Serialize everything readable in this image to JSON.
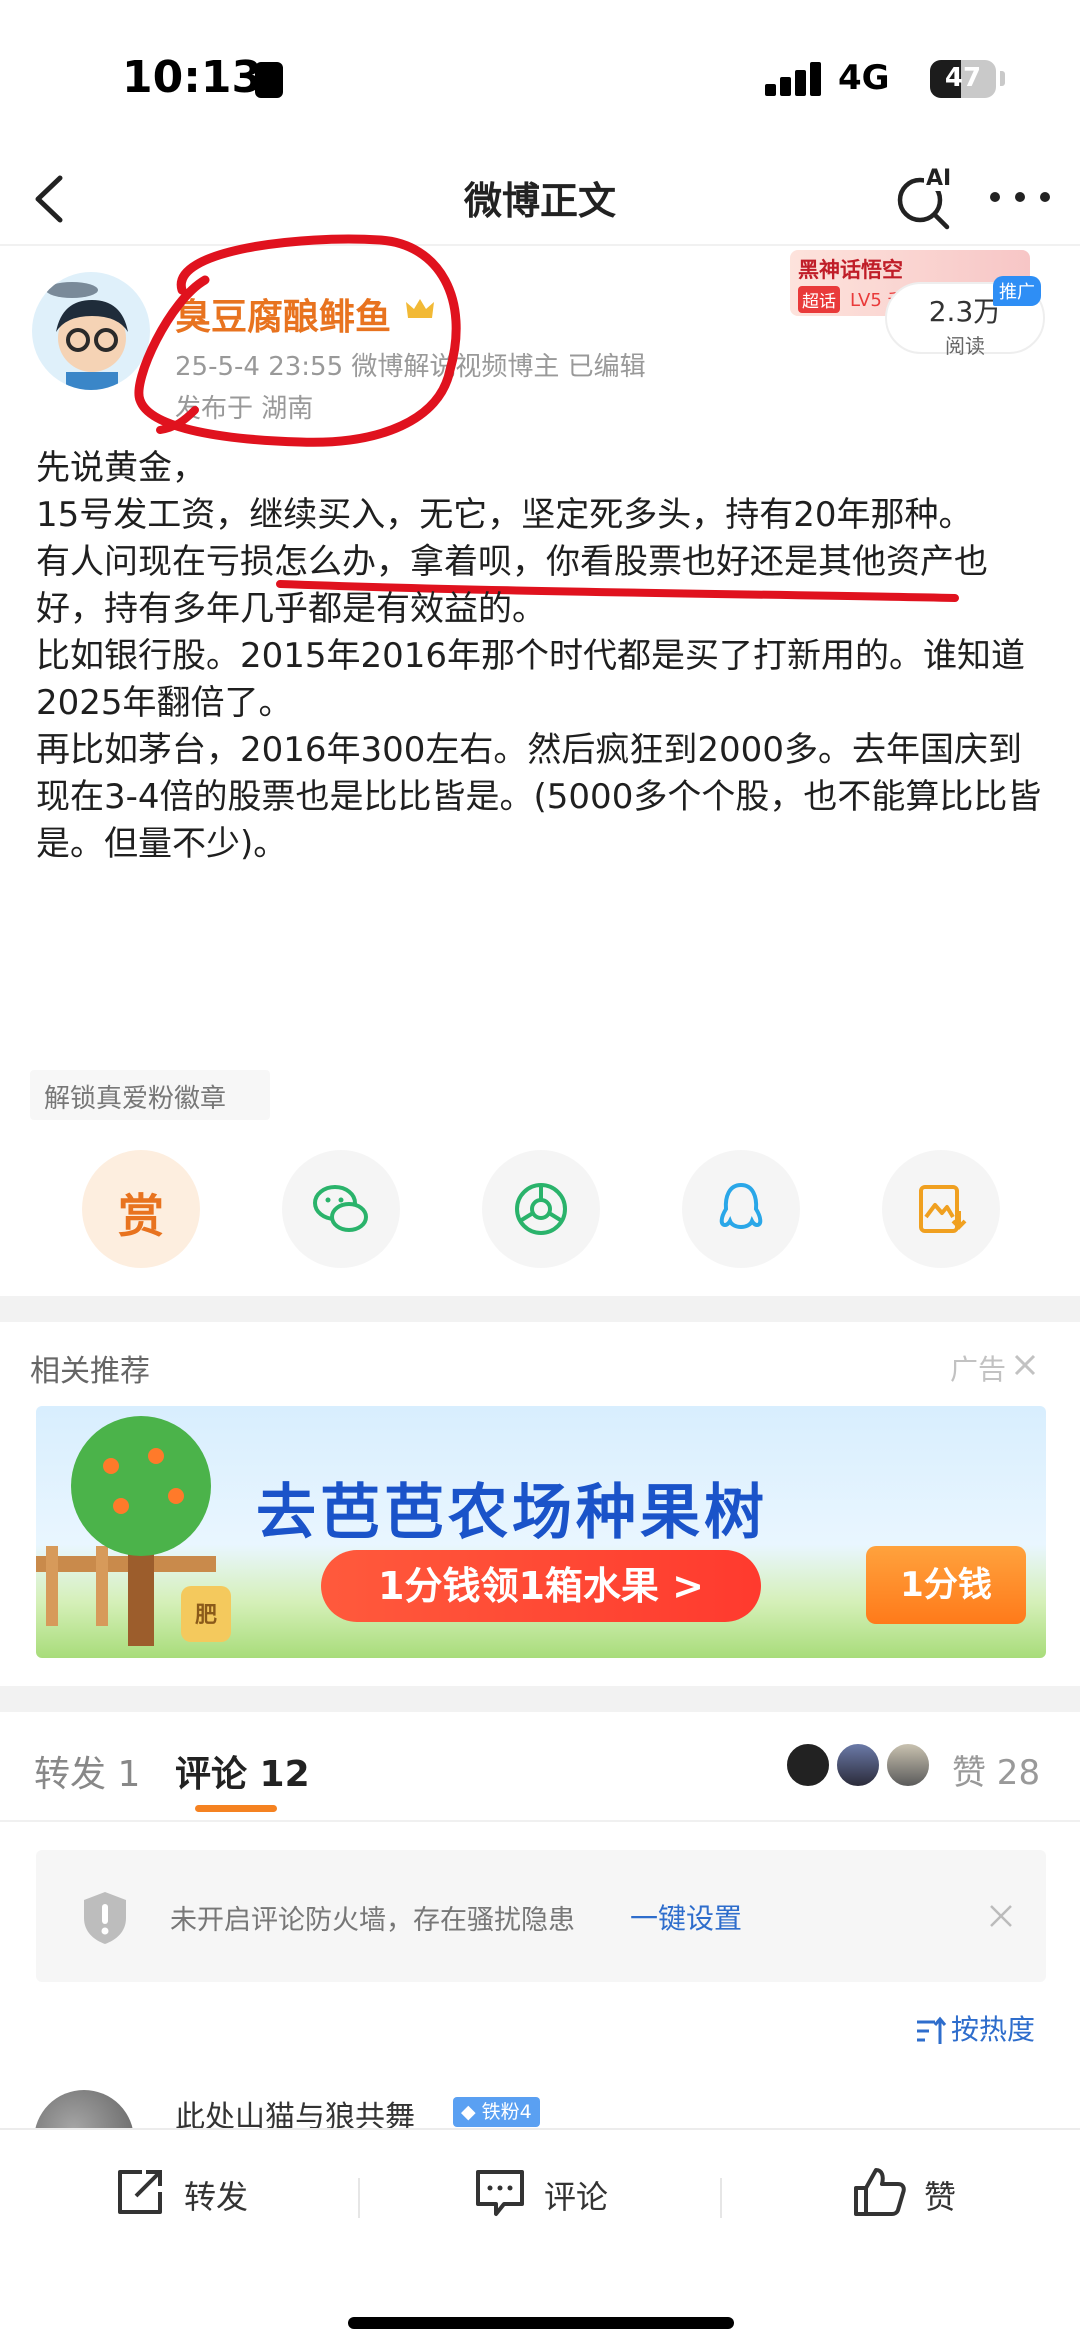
{
  "status_bar": {
    "time": "10:13",
    "network": "4G",
    "battery": "47",
    "battery_level": 0.47
  },
  "nav": {
    "title": "微博正文",
    "ai_label": "AI"
  },
  "author": {
    "name": "臭豆腐酿鲱鱼",
    "meta": "25-5-4 23:55  微博解说视频博主  已编辑",
    "location": "发布于 湖南"
  },
  "badge": {
    "title": "黑神话悟空",
    "tag": "超话",
    "level": "LV5 千"
  },
  "read": {
    "count": "2.3万",
    "label": "阅读",
    "promo": "推广"
  },
  "post": {
    "lines": [
      "先说黄金，",
      "15号发工资，继续买入，无它，坚定死多头，持有20年那种。",
      "有人问现在亏损怎么办，拿着呗，你看股票也好还是其他资产也好，持有多年几乎都是有效益的。",
      "比如银行股。2015年2016年那个时代都是买了打新用的。谁知道2025年翻倍了。",
      "再比如茅台，2016年300左右。然后疯狂到2000多。去年国庆到现在3-4倍的股票也是比比皆是。(5000多个个股，也不能算比比皆是。但量不少)。"
    ]
  },
  "unlock": {
    "label": "解锁真爱粉徽章"
  },
  "share": {
    "reward": "赏"
  },
  "related": {
    "title": "相关推荐",
    "ad_label": "广告"
  },
  "ad": {
    "title": "去芭芭农场种果树",
    "pill": "1分钱领1箱水果 >",
    "price": "1分钱",
    "bag": "肥"
  },
  "tabs": {
    "repost": "转发 1",
    "comment": "评论 12",
    "likes": "赞 28"
  },
  "firewall": {
    "text": "未开启评论防火墙，存在骚扰隐患",
    "link": "一键设置"
  },
  "sort": {
    "label": "按热度"
  },
  "comment": {
    "user": "此处山猫与狼共舞",
    "badge": "铁粉4"
  },
  "bottom": {
    "repost": "转发",
    "comment": "评论",
    "like": "赞"
  },
  "colors": {
    "accent": "#e8731f",
    "link": "#2e6dcc",
    "annotation": "#e0121e"
  }
}
